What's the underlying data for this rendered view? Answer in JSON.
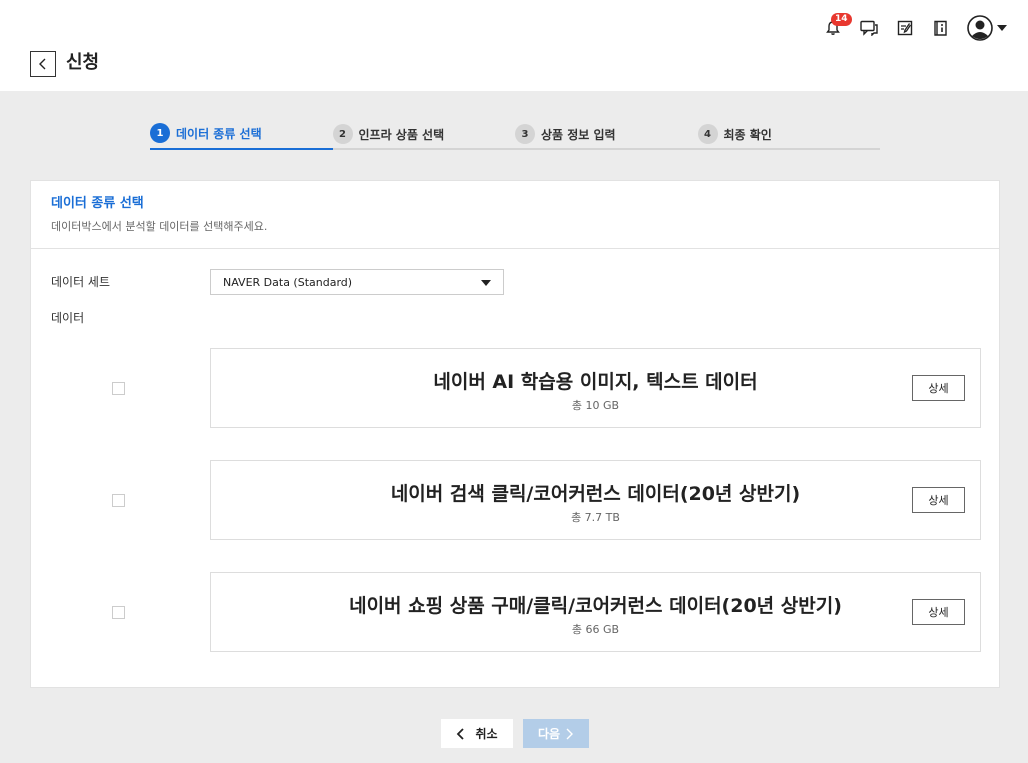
{
  "header": {
    "notification_count": "14",
    "page_title": "신청"
  },
  "steps": [
    {
      "num": "1",
      "label": "데이터 종류 선택"
    },
    {
      "num": "2",
      "label": "인프라 상품 선택"
    },
    {
      "num": "3",
      "label": "상품 정보 입력"
    },
    {
      "num": "4",
      "label": "최종 확인"
    }
  ],
  "card": {
    "title": "데이터 종류 선택",
    "description": "데이터박스에서 분석할 데이터를 선택해주세요.",
    "dataset_label": "데이터 세트",
    "dataset_value": "NAVER Data (Standard)",
    "data_label": "데이터"
  },
  "items": [
    {
      "title": "네이버 AI 학습용 이미지, 텍스트 데이터",
      "size": "총 10 GB",
      "detail": "상세"
    },
    {
      "title": "네이버 검색 클릭/코어커런스 데이터(20년 상반기)",
      "size": "총 7.7 TB",
      "detail": "상세"
    },
    {
      "title": "네이버 쇼핑 상품 구매/클릭/코어커런스 데이터(20년 상반기)",
      "size": "총 66 GB",
      "detail": "상세"
    }
  ],
  "footer": {
    "cancel_label": "취소",
    "next_label": "다음"
  }
}
